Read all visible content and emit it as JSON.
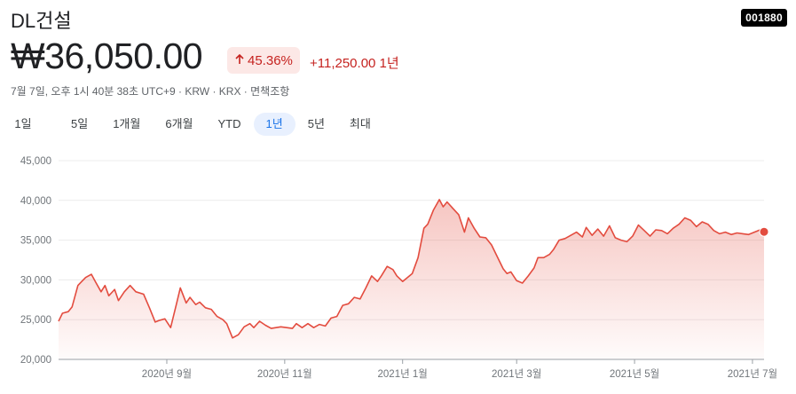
{
  "stock": {
    "name": "DL건설",
    "ticker": "001880",
    "price": "₩36,050.00",
    "change_pct": "45.36%",
    "change_abs": "+11,250.00 1년",
    "meta": "7월 7일, 오후 1시 40분 38초 UTC+9 · KRW · KRX · 면책조항",
    "colors": {
      "up": "#c5221f",
      "up_bg": "#fce8e6",
      "line": "#e34c3f",
      "active_tab": "#1a73e8"
    },
    "icons": {
      "change_arrow": "arrow-up-icon"
    }
  },
  "tabs": [
    {
      "label": "1일",
      "active": false
    },
    {
      "label": "5일",
      "active": false
    },
    {
      "label": "1개월",
      "active": false
    },
    {
      "label": "6개월",
      "active": false
    },
    {
      "label": "YTD",
      "active": false
    },
    {
      "label": "1년",
      "active": true
    },
    {
      "label": "5년",
      "active": false
    },
    {
      "label": "최대",
      "active": false
    }
  ],
  "chart_data": {
    "type": "area",
    "title": "",
    "xlabel": "",
    "ylabel": "",
    "ylim": [
      20000,
      45000
    ],
    "y_ticks": [
      "45,000",
      "40,000",
      "35,000",
      "30,000",
      "25,000",
      "20,000"
    ],
    "y_tick_values": [
      45000,
      40000,
      35000,
      30000,
      25000,
      20000
    ],
    "x_range": [
      "2020-07-07",
      "2021-07-07"
    ],
    "x_ticks": [
      {
        "date": "2020-09-01",
        "label": "2020년 9월"
      },
      {
        "date": "2020-11-01",
        "label": "2020년 11월"
      },
      {
        "date": "2021-01-01",
        "label": "2021년 1월"
      },
      {
        "date": "2021-03-01",
        "label": "2021년 3월"
      },
      {
        "date": "2021-05-01",
        "label": "2021년 5월"
      },
      {
        "date": "2021-07-01",
        "label": "2021년 7월"
      }
    ],
    "grid": true,
    "series": [
      {
        "points": [
          [
            "2020-07-07",
            24800
          ],
          [
            "2020-07-09",
            25800
          ],
          [
            "2020-07-12",
            26000
          ],
          [
            "2020-07-14",
            26600
          ],
          [
            "2020-07-17",
            29300
          ],
          [
            "2020-07-19",
            29800
          ],
          [
            "2020-07-21",
            30300
          ],
          [
            "2020-07-24",
            30700
          ],
          [
            "2020-07-26",
            29800
          ],
          [
            "2020-07-29",
            28500
          ],
          [
            "2020-07-31",
            29300
          ],
          [
            "2020-08-02",
            28000
          ],
          [
            "2020-08-05",
            28800
          ],
          [
            "2020-08-07",
            27400
          ],
          [
            "2020-08-10",
            28500
          ],
          [
            "2020-08-13",
            29300
          ],
          [
            "2020-08-16",
            28500
          ],
          [
            "2020-08-20",
            28200
          ],
          [
            "2020-08-23",
            26500
          ],
          [
            "2020-08-26",
            24700
          ],
          [
            "2020-08-28",
            24900
          ],
          [
            "2020-08-31",
            25100
          ],
          [
            "2020-09-03",
            24000
          ],
          [
            "2020-09-06",
            27000
          ],
          [
            "2020-09-08",
            29000
          ],
          [
            "2020-09-11",
            27100
          ],
          [
            "2020-09-13",
            27800
          ],
          [
            "2020-09-16",
            26900
          ],
          [
            "2020-09-18",
            27200
          ],
          [
            "2020-09-21",
            26500
          ],
          [
            "2020-09-24",
            26300
          ],
          [
            "2020-09-27",
            25400
          ],
          [
            "2020-09-30",
            25000
          ],
          [
            "2020-10-02",
            24500
          ],
          [
            "2020-10-05",
            22700
          ],
          [
            "2020-10-08",
            23100
          ],
          [
            "2020-10-11",
            24100
          ],
          [
            "2020-10-14",
            24500
          ],
          [
            "2020-10-16",
            24000
          ],
          [
            "2020-10-19",
            24800
          ],
          [
            "2020-10-22",
            24300
          ],
          [
            "2020-10-25",
            23900
          ],
          [
            "2020-10-30",
            24100
          ],
          [
            "2020-11-02",
            24000
          ],
          [
            "2020-11-05",
            23900
          ],
          [
            "2020-11-07",
            24500
          ],
          [
            "2020-11-10",
            24000
          ],
          [
            "2020-11-13",
            24500
          ],
          [
            "2020-11-16",
            24000
          ],
          [
            "2020-11-19",
            24400
          ],
          [
            "2020-11-22",
            24200
          ],
          [
            "2020-11-25",
            25200
          ],
          [
            "2020-11-28",
            25400
          ],
          [
            "2020-12-01",
            26800
          ],
          [
            "2020-12-04",
            27000
          ],
          [
            "2020-12-07",
            27800
          ],
          [
            "2020-12-10",
            27600
          ],
          [
            "2020-12-13",
            29000
          ],
          [
            "2020-12-16",
            30500
          ],
          [
            "2020-12-19",
            29800
          ],
          [
            "2020-12-21",
            30500
          ],
          [
            "2020-12-24",
            31700
          ],
          [
            "2020-12-27",
            31300
          ],
          [
            "2020-12-29",
            30500
          ],
          [
            "2021-01-01",
            29800
          ],
          [
            "2021-01-03",
            30200
          ],
          [
            "2021-01-06",
            30800
          ],
          [
            "2021-01-09",
            32800
          ],
          [
            "2021-01-12",
            36500
          ],
          [
            "2021-01-14",
            37000
          ],
          [
            "2021-01-17",
            38800
          ],
          [
            "2021-01-20",
            40100
          ],
          [
            "2021-01-22",
            39200
          ],
          [
            "2021-01-24",
            39800
          ],
          [
            "2021-01-27",
            39000
          ],
          [
            "2021-01-30",
            38200
          ],
          [
            "2021-02-02",
            36000
          ],
          [
            "2021-02-04",
            37800
          ],
          [
            "2021-02-07",
            36500
          ],
          [
            "2021-02-10",
            35400
          ],
          [
            "2021-02-13",
            35300
          ],
          [
            "2021-02-16",
            34400
          ],
          [
            "2021-02-19",
            32900
          ],
          [
            "2021-02-22",
            31400
          ],
          [
            "2021-02-24",
            30800
          ],
          [
            "2021-02-26",
            31000
          ],
          [
            "2021-03-01",
            29900
          ],
          [
            "2021-03-04",
            29600
          ],
          [
            "2021-03-07",
            30500
          ],
          [
            "2021-03-10",
            31500
          ],
          [
            "2021-03-12",
            32800
          ],
          [
            "2021-03-15",
            32800
          ],
          [
            "2021-03-18",
            33200
          ],
          [
            "2021-03-20",
            33800
          ],
          [
            "2021-03-23",
            35000
          ],
          [
            "2021-03-26",
            35200
          ],
          [
            "2021-03-29",
            35600
          ],
          [
            "2021-04-01",
            36000
          ],
          [
            "2021-04-04",
            35400
          ],
          [
            "2021-04-06",
            36600
          ],
          [
            "2021-04-09",
            35600
          ],
          [
            "2021-04-12",
            36400
          ],
          [
            "2021-04-15",
            35500
          ],
          [
            "2021-04-18",
            36800
          ],
          [
            "2021-04-21",
            35300
          ],
          [
            "2021-04-24",
            35000
          ],
          [
            "2021-04-27",
            34800
          ],
          [
            "2021-04-30",
            35500
          ],
          [
            "2021-05-03",
            36900
          ],
          [
            "2021-05-06",
            36200
          ],
          [
            "2021-05-09",
            35500
          ],
          [
            "2021-05-12",
            36300
          ],
          [
            "2021-05-15",
            36200
          ],
          [
            "2021-05-18",
            35800
          ],
          [
            "2021-05-21",
            36500
          ],
          [
            "2021-05-24",
            37000
          ],
          [
            "2021-05-27",
            37800
          ],
          [
            "2021-05-30",
            37500
          ],
          [
            "2021-06-02",
            36700
          ],
          [
            "2021-06-05",
            37300
          ],
          [
            "2021-06-08",
            37000
          ],
          [
            "2021-06-11",
            36200
          ],
          [
            "2021-06-14",
            35800
          ],
          [
            "2021-06-17",
            36000
          ],
          [
            "2021-06-20",
            35700
          ],
          [
            "2021-06-23",
            35900
          ],
          [
            "2021-06-26",
            35800
          ],
          [
            "2021-06-29",
            35700
          ],
          [
            "2021-07-02",
            36000
          ],
          [
            "2021-07-05",
            36300
          ],
          [
            "2021-07-07",
            36050
          ]
        ]
      }
    ]
  }
}
